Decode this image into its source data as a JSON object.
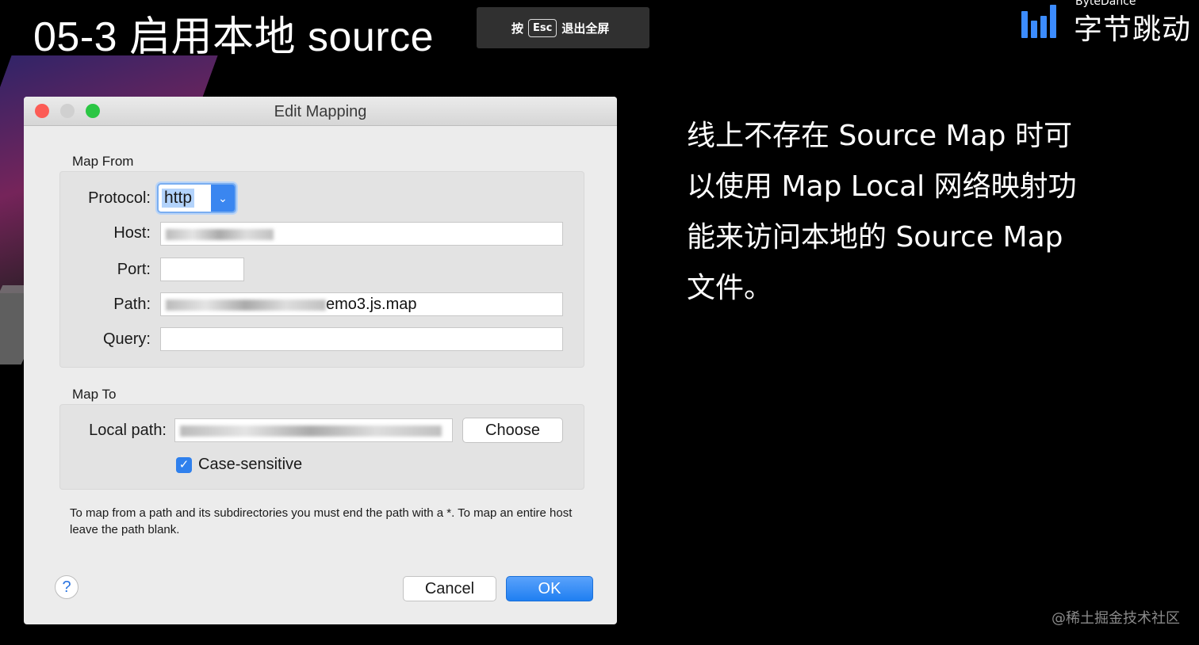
{
  "slide": {
    "title": "05-3 启用本地 source",
    "body": "线上不存在 Source Map 时可以使用 Map Local 网络映射功能来访问本地的 Source Map 文件。"
  },
  "esc_toast": {
    "press": "按",
    "key": "Esc",
    "action": "退出全屏"
  },
  "logo": {
    "english": "ByteDance",
    "chinese": "字节跳动",
    "color": "#3c8cff"
  },
  "dialog": {
    "title": "Edit Mapping",
    "map_from": {
      "section": "Map From",
      "protocol_label": "Protocol:",
      "protocol_value": "http",
      "host_label": "Host:",
      "host_value": "",
      "port_label": "Port:",
      "port_value": "",
      "path_label": "Path:",
      "path_value": "emo3.js.map",
      "query_label": "Query:",
      "query_value": ""
    },
    "map_to": {
      "section": "Map To",
      "local_path_label": "Local path:",
      "local_path_value": "",
      "choose_button": "Choose",
      "case_sensitive_label": "Case-sensitive",
      "case_sensitive_checked": true
    },
    "hint": "To map from a path and its subdirectories you must end the path with a *. To map an entire host leave the path blank.",
    "help": "?",
    "cancel_button": "Cancel",
    "ok_button": "OK"
  },
  "watermark": "@稀土掘金技术社区"
}
